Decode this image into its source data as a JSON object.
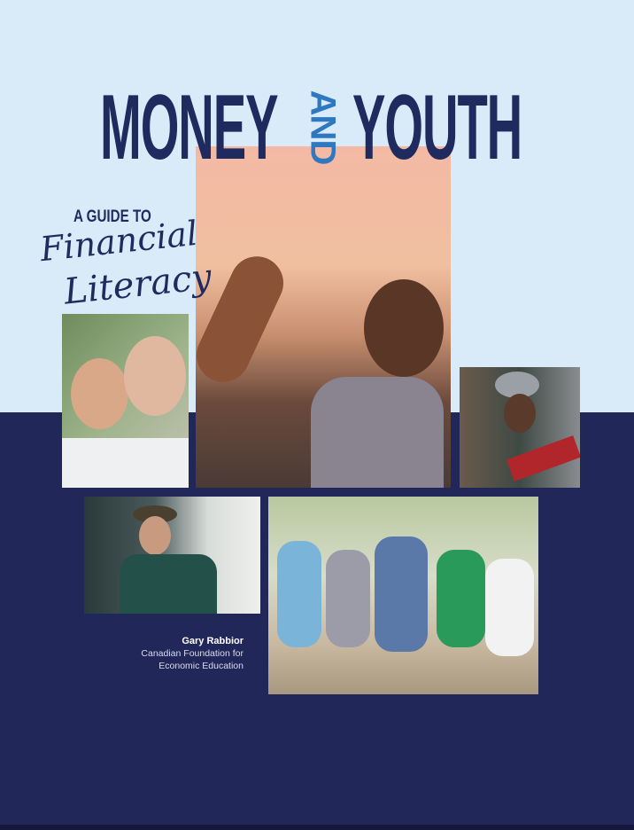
{
  "cover": {
    "title_left": "MONEY",
    "title_middle": "AND",
    "title_right": "YOUTH",
    "subtitle_prefix": "A GUIDE TO",
    "subtitle_line1": "Financial",
    "subtitle_line2": "Literacy",
    "author_name": "Gary Rabbior",
    "organization_line1": "Canadian Foundation for",
    "organization_line2": "Economic Education"
  },
  "colors": {
    "light_blue": "#d9ebf8",
    "navy": "#22275a",
    "title": "#1f2b5e",
    "accent": "#2f78c0"
  }
}
